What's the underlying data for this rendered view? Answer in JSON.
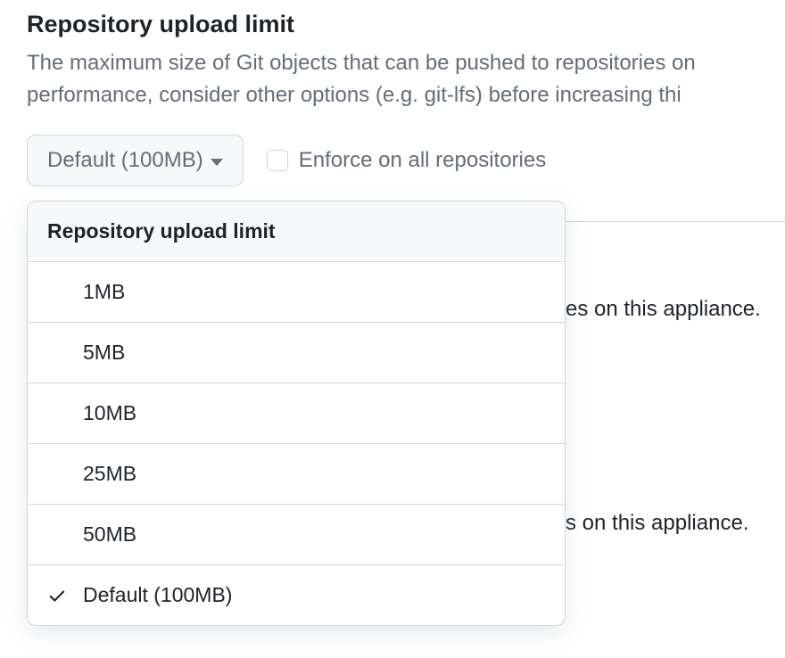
{
  "section": {
    "title": "Repository upload limit",
    "description_line1": "The maximum size of Git objects that can be pushed to repositories on",
    "description_line2": "performance, consider other options (e.g. git-lfs) before increasing thi"
  },
  "controls": {
    "dropdown_current": "Default (100MB)",
    "enforce_label": "Enforce on all repositories",
    "enforce_checked": false
  },
  "dropdown": {
    "header": "Repository upload limit",
    "items": [
      {
        "label": "1MB",
        "selected": false
      },
      {
        "label": "5MB",
        "selected": false
      },
      {
        "label": "10MB",
        "selected": false
      },
      {
        "label": "25MB",
        "selected": false
      },
      {
        "label": "50MB",
        "selected": false
      },
      {
        "label": "Default (100MB)",
        "selected": true
      }
    ]
  },
  "background_fragments": {
    "frag1": "es on this appliance.",
    "frag2": "s on this appliance."
  }
}
